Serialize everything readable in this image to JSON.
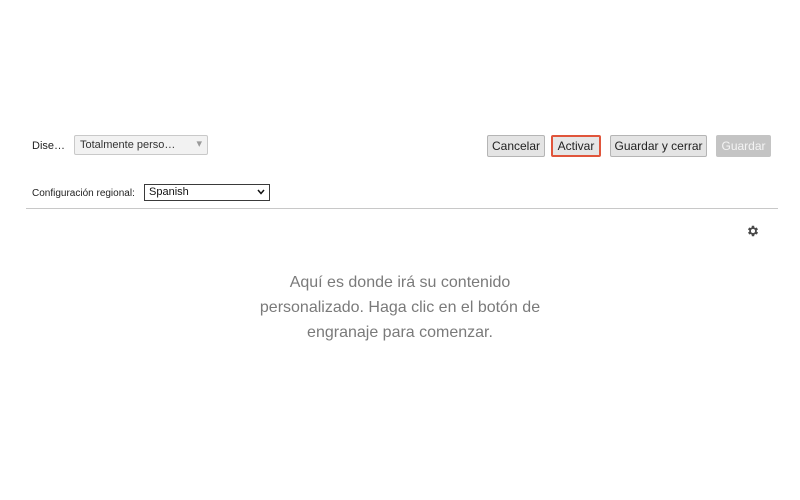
{
  "toolbar": {
    "design_label": "Dise…",
    "design_value": "Totalmente perso…",
    "buttons": {
      "cancel": "Cancelar",
      "activate": "Activar",
      "save_and_close": "Guardar y cerrar",
      "save": "Guardar"
    }
  },
  "locale": {
    "label": "Configuración regional:",
    "value": "Spanish"
  },
  "main": {
    "settings_icon": "gear-icon",
    "placeholder_lines": [
      "Aquí es donde irá su contenido",
      "personalizado. Haga clic en el botón de",
      "engranaje para comenzar."
    ]
  },
  "colors": {
    "activate_border": "#e0553b",
    "disabled_button": "#c4c4c4"
  }
}
